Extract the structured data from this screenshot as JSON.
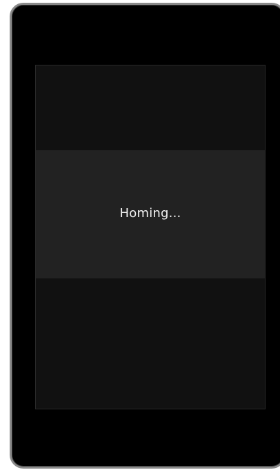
{
  "dialog": {
    "message": "Homing..."
  },
  "colors": {
    "device_frame": "#8a8a8a",
    "device_body": "#000000",
    "screen_background": "#111111",
    "dialog_background": "#222222",
    "text": "#f2f2f2"
  }
}
